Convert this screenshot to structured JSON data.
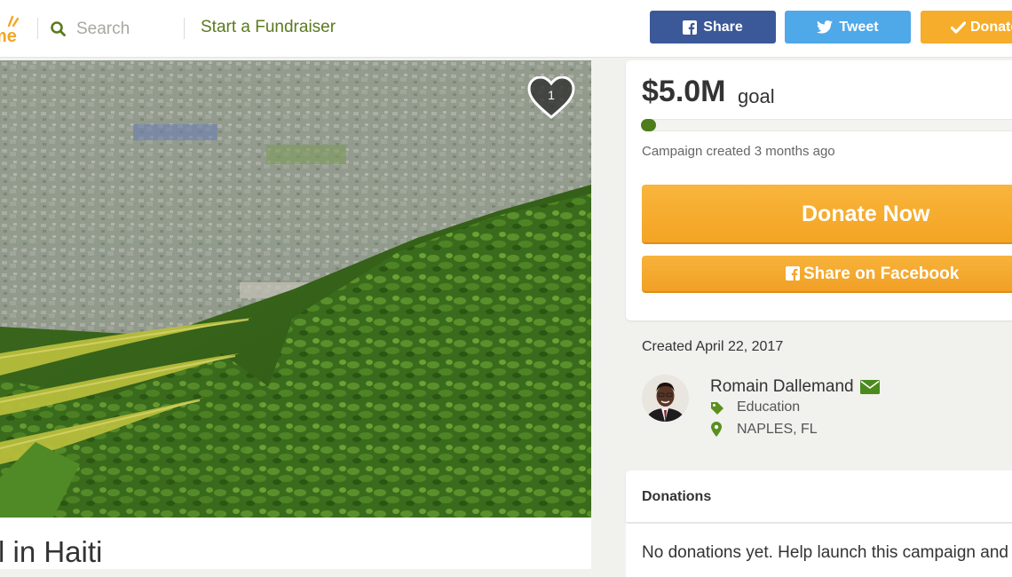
{
  "header": {
    "logo_fragment": "me",
    "search_placeholder": "Search",
    "start_fundraiser": "Start a Fundraiser",
    "share_label": "Share",
    "tweet_label": "Tweet",
    "donate_label": "Donate"
  },
  "photo": {
    "heart_count": "1"
  },
  "campaign": {
    "title_fragment": "l in Haiti"
  },
  "goal": {
    "amount": "$5.0M",
    "word": "goal",
    "progress_fraction": 0.04,
    "created_ago": "Campaign created 3 months ago",
    "donate_now": "Donate Now",
    "share_facebook": "Share on Facebook"
  },
  "organizer": {
    "created_date": "Created April 22, 2017",
    "name": "Romain Dallemand",
    "category": "Education",
    "location": "NAPLES, FL"
  },
  "donations": {
    "heading": "Donations",
    "empty_text": "No donations yet. Help launch this campaign and"
  },
  "colors": {
    "facebook": "#3b5998",
    "twitter": "#4fa8e8",
    "donate_orange": "#f6ad2b",
    "brand_green": "#5a7a1e",
    "progress_green": "#4c7d1a"
  },
  "icons": [
    "search-icon",
    "facebook-icon",
    "twitter-icon",
    "checkmark-icon",
    "heart-icon",
    "envelope-icon",
    "tag-icon",
    "map-pin-icon"
  ]
}
